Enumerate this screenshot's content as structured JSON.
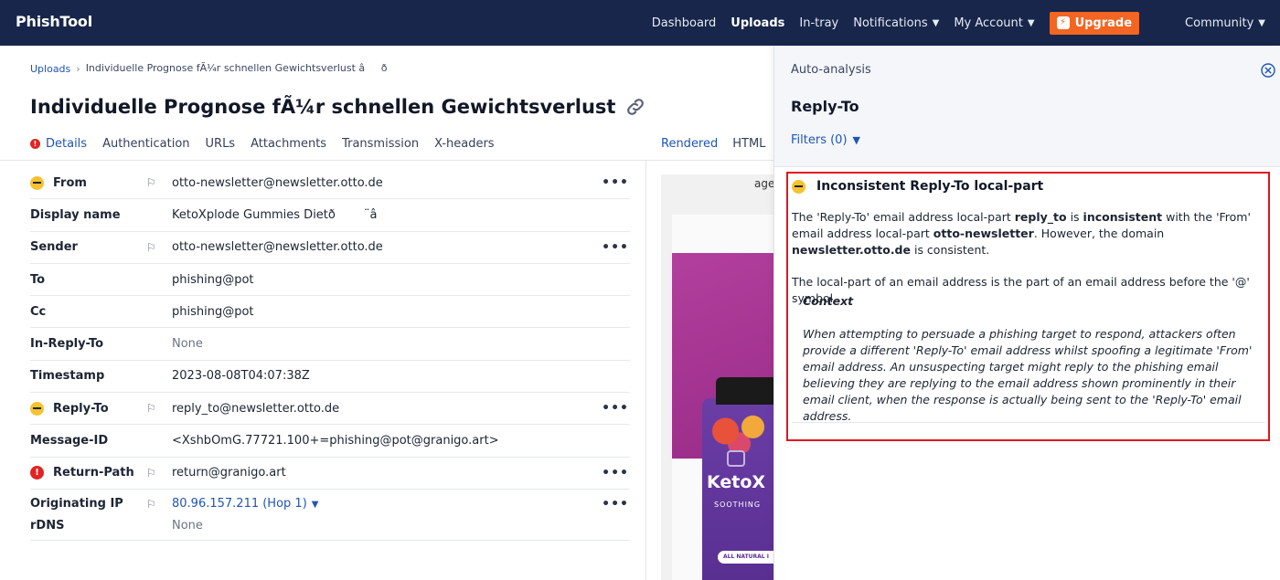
{
  "nav": {
    "brand": "PhishTool",
    "items": [
      {
        "label": "Dashboard",
        "active": false,
        "dropdown": false
      },
      {
        "label": "Uploads",
        "active": true,
        "dropdown": false
      },
      {
        "label": "In-tray",
        "active": false,
        "dropdown": false
      },
      {
        "label": "Notifications",
        "active": false,
        "dropdown": true
      },
      {
        "label": "My Account",
        "active": false,
        "dropdown": true
      }
    ],
    "upgrade": "Upgrade",
    "community": "Community",
    "colors": {
      "bar": "#17264a",
      "upgrade": "#f26522"
    }
  },
  "breadcrumb": {
    "root": "Uploads",
    "current": "Individuelle Prognose fÃ¼r schnellen Gewichtsverlust âð"
  },
  "title": "Individuelle Prognose fÃ¼r schnellen Gewichtsverlust â...",
  "tabs": [
    "Details",
    "Authentication",
    "URLs",
    "Attachments",
    "Transmission",
    "X-headers"
  ],
  "view_tabs": [
    "Rendered",
    "HTML"
  ],
  "headers": [
    {
      "label": "From",
      "status": "warning",
      "flag": true,
      "value": "otto-newsletter@newsletter.otto.de",
      "menu": true
    },
    {
      "label": "Display name",
      "status": "",
      "flag": false,
      "value": "KetoXplode Gummies Dietð¨â",
      "menu": false
    },
    {
      "label": "Sender",
      "status": "",
      "flag": true,
      "value": "otto-newsletter@newsletter.otto.de",
      "menu": true
    },
    {
      "label": "To",
      "status": "",
      "flag": false,
      "value": "phishing@pot",
      "menu": false
    },
    {
      "label": "Cc",
      "status": "",
      "flag": false,
      "value": "phishing@pot",
      "menu": false
    },
    {
      "label": "In-Reply-To",
      "status": "",
      "flag": false,
      "value": "None",
      "menu": false
    },
    {
      "label": "Timestamp",
      "status": "",
      "flag": false,
      "value": "2023-08-08T04:07:38Z",
      "menu": false
    },
    {
      "label": "Reply-To",
      "status": "warning",
      "flag": true,
      "value": "reply_to@newsletter.otto.de",
      "menu": true
    },
    {
      "label": "Message-ID",
      "status": "",
      "flag": false,
      "value": "<XshbOmG.77721.100+=phishing@pot@granigo.art>",
      "menu": false
    },
    {
      "label": "Return-Path",
      "status": "error",
      "flag": true,
      "value": "return@granigo.art",
      "menu": true
    }
  ],
  "originating_ip": {
    "label": "Originating IP",
    "value": "80.96.157.211 (Hop 1)",
    "rdns_label": "rDNS",
    "rdns_value": "None"
  },
  "preview": {
    "text": "age",
    "brand": "KetoX",
    "sub": "SOOTHING",
    "badge": "ALL NATURAL I"
  },
  "panel": {
    "subtitle": "Auto-analysis",
    "title": "Reply-To",
    "filters": "Filters (0)",
    "card": {
      "title": "Inconsistent Reply-To local-part",
      "p1_a": "The 'Reply-To' email address local-part ",
      "p1_b": "reply_to",
      "p1_c": " is ",
      "p1_d": "inconsistent",
      "p1_e": " with the 'From' email address local-part ",
      "p1_f": "otto-newsletter",
      "p1_g": ". However, the domain ",
      "p1_h": "newsletter.otto.de",
      "p1_i": " is consistent.",
      "p2": "The local-part of an email address is the part of an email address before the '@' symbol.",
      "context_title": "Context",
      "context_body": "When attempting to persuade a phishing target to respond, attackers often provide a different 'Reply-To' email address whilst spoofing a legitimate 'From' email address. An unsuspecting target might reply to the phishing email believing they are replying to the email address shown prominently in their email client, when the response is actually being sent to the 'Reply-To' email address."
    }
  }
}
